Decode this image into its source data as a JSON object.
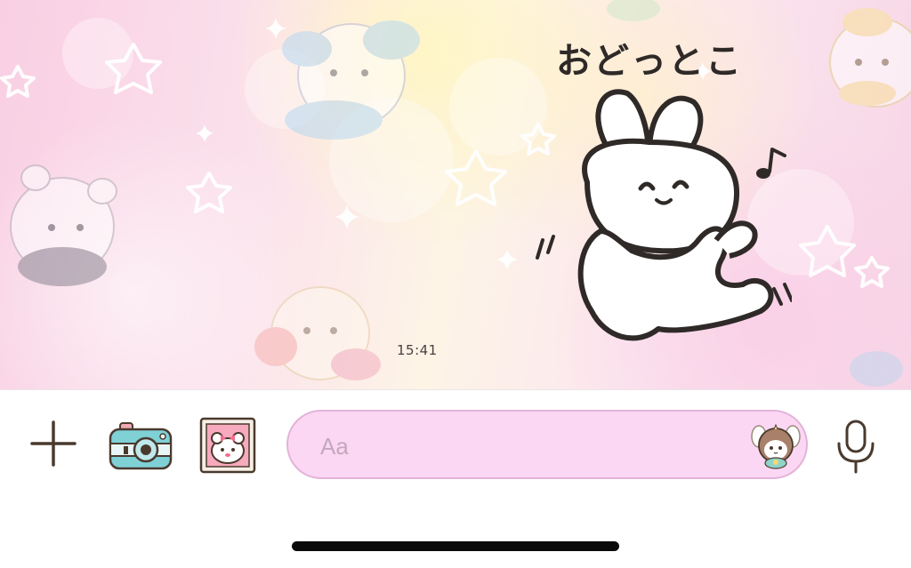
{
  "chat": {
    "message_time": "15:41",
    "sticker_caption": "おどっとこ"
  },
  "input_bar": {
    "placeholder": "Aa"
  },
  "icons": {
    "plus": "plus-icon",
    "camera": "camera-icon",
    "image": "image-icon",
    "sticker": "sticker-icon",
    "mic": "microphone-icon"
  },
  "colors": {
    "input_field_bg": "#fcd7f4",
    "input_field_border": "#e2b3d9",
    "icon_stroke": "#4a3a2e",
    "camera_body": "#7fd1d6",
    "home_indicator": "#0a0a0a"
  }
}
